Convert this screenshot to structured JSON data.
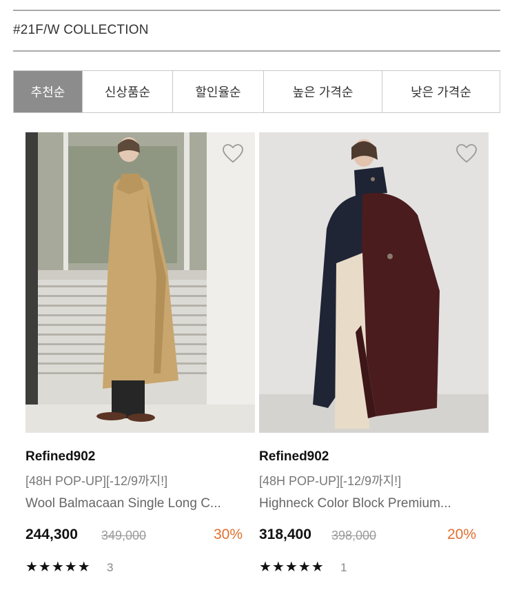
{
  "section": {
    "title": "#21F/W COLLECTION"
  },
  "sort_tabs": [
    {
      "label": "추천순",
      "active": true
    },
    {
      "label": "신상품순",
      "active": false
    },
    {
      "label": "할인율순",
      "active": false
    },
    {
      "label": "높은 가격순",
      "active": false
    },
    {
      "label": "낮은 가격순",
      "active": false
    }
  ],
  "products": [
    {
      "brand": "Refined902",
      "promo": "[48H POP-UP][-12/9까지!]",
      "name": "Wool Balmacaan Single Long C...",
      "price": "244,300",
      "original_price": "349,000",
      "discount": "30%",
      "rating_stars": "★★★★★",
      "review_count": "3",
      "wishlist_icon": "heart-outline-icon"
    },
    {
      "brand": "Refined902",
      "promo": "[48H POP-UP][-12/9까지!]",
      "name": "Highneck Color Block Premium...",
      "price": "318,400",
      "original_price": "398,000",
      "discount": "20%",
      "rating_stars": "★★★★★",
      "review_count": "1",
      "wishlist_icon": "heart-outline-icon"
    }
  ],
  "colors": {
    "active_tab": "#8c8c8c",
    "discount": "#e07030",
    "divider": "#a9a9a9"
  }
}
